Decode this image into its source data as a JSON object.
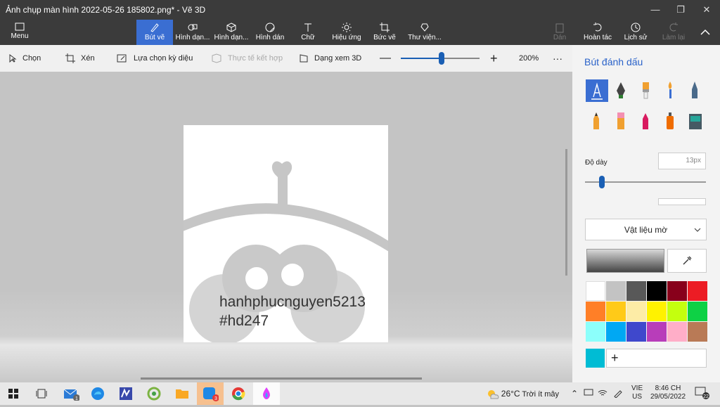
{
  "window": {
    "title": "Ảnh chụp màn hình 2022-05-26 185802.png* - Vẽ 3D"
  },
  "ribbon": {
    "menu": "Menu",
    "tabs": [
      "Bút vẽ",
      "Hình dạn...",
      "Hình dạn...",
      "Hình dán",
      "Chữ",
      "Hiệu ứng",
      "Bức vẽ",
      "Thư viện..."
    ],
    "paste": "Dán",
    "undo": "Hoàn tác",
    "history": "Lịch sử",
    "redo": "Làm lại"
  },
  "toolbar": {
    "select": "Chọn",
    "crop": "Xén",
    "magic_select": "Lựa chọn kỳ diệu",
    "mixed_reality": "Thực tế kết hợp",
    "view3d": "Dạng xem 3D",
    "zoom": "200%",
    "zoom_value": 0.52,
    "more": "···"
  },
  "canvas": {
    "text_line1": "hanhphucnguyen5213",
    "text_line2": "#hd247"
  },
  "panel": {
    "title": "Bút đánh dấu",
    "thickness_label": "Độ dày",
    "thickness_value": "13px",
    "thickness_level": 0.14,
    "material": "Vật liệu mờ",
    "add": "+",
    "current_color": "#00bcd4",
    "palette": [
      "#ffffff",
      "#c3c3c3",
      "#585858",
      "#000000",
      "#88001b",
      "#ec1c24",
      "#ff7f27",
      "#ffca18",
      "#fdeca6",
      "#fff200",
      "#c4ff0e",
      "#0ed145",
      "#8cfffb",
      "#00a8f3",
      "#3f48cc",
      "#b83dba",
      "#ffaec8",
      "#b97a56"
    ],
    "brushes": [
      "marker-icon",
      "calligraphy-pen-icon",
      "oil-brush-icon",
      "watercolor-icon",
      "pixel-pen-icon",
      "pencil-icon",
      "eraser-icon",
      "crayon-icon",
      "spray-can-icon",
      "fill-bucket-icon"
    ]
  },
  "taskbar": {
    "weather_temp": "26°C",
    "weather_text": "Trời ít mây",
    "lang1": "VIE",
    "lang2": "US",
    "time": "8:46 CH",
    "date": "29/05/2022",
    "notif": "22",
    "badge_mail": "1",
    "badge_zalo": "3"
  }
}
